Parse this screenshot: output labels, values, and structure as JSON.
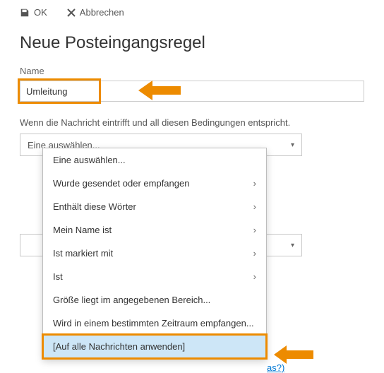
{
  "toolbar": {
    "ok_label": "OK",
    "cancel_label": "Abbrechen"
  },
  "title": "Neue Posteingangsregel",
  "name_field": {
    "label": "Name",
    "value": "Umleitung"
  },
  "condition_section": {
    "label": "Wenn die Nachricht eintrifft und all diesen Bedingungen entspricht.",
    "selected": "Eine auswählen...",
    "options": [
      {
        "label": "Eine auswählen...",
        "has_sub": false
      },
      {
        "label": "Wurde gesendet oder empfangen",
        "has_sub": true
      },
      {
        "label": "Enthält diese Wörter",
        "has_sub": true
      },
      {
        "label": "Mein Name ist",
        "has_sub": true
      },
      {
        "label": "Ist markiert mit",
        "has_sub": true
      },
      {
        "label": "Ist",
        "has_sub": true
      },
      {
        "label": "Größe liegt im angegebenen Bereich...",
        "has_sub": false
      },
      {
        "label": "Wird in einem bestimmten Zeitraum empfangen...",
        "has_sub": false
      },
      {
        "label": "[Auf alle Nachrichten anwenden]",
        "has_sub": false,
        "highlighted": true
      }
    ]
  },
  "link_fragment": "as?)",
  "chevron": "▾",
  "submenu_glyph": "›"
}
